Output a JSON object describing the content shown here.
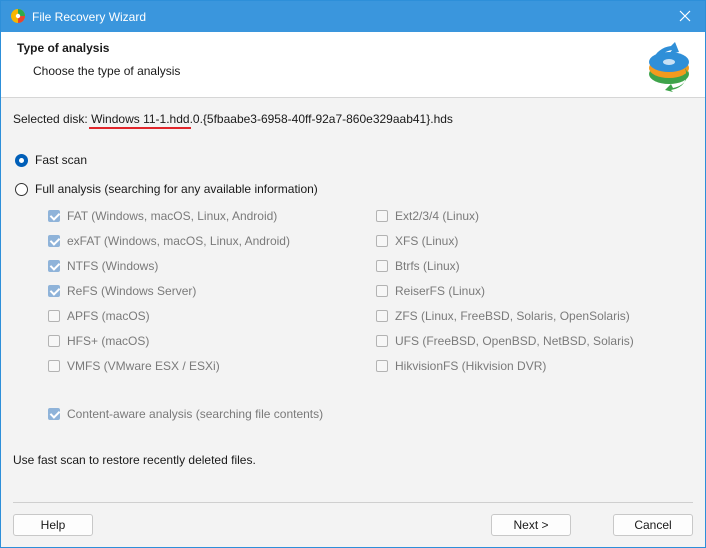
{
  "window": {
    "title": "File Recovery Wizard"
  },
  "header": {
    "title": "Type of analysis",
    "subtitle": "Choose the type of analysis"
  },
  "disk": {
    "label": "Selected disk:",
    "name": "Windows 11-1.hdd",
    "suffix": ".0.{5fbaabe3-6958-40ff-92a7-860e329aab41}.hds"
  },
  "scan_options": {
    "fast": {
      "label": "Fast scan",
      "selected": true
    },
    "full": {
      "label": "Full analysis (searching for any available information)",
      "selected": false
    }
  },
  "filesystems_left": [
    {
      "label": "FAT (Windows, macOS, Linux, Android)",
      "checked": true
    },
    {
      "label": "exFAT (Windows, macOS, Linux, Android)",
      "checked": true
    },
    {
      "label": "NTFS (Windows)",
      "checked": true
    },
    {
      "label": "ReFS (Windows Server)",
      "checked": true
    },
    {
      "label": "APFS (macOS)",
      "checked": false
    },
    {
      "label": "HFS+ (macOS)",
      "checked": false
    },
    {
      "label": "VMFS (VMware ESX / ESXi)",
      "checked": false
    }
  ],
  "filesystems_right": [
    {
      "label": "Ext2/3/4 (Linux)",
      "checked": false
    },
    {
      "label": "XFS (Linux)",
      "checked": false
    },
    {
      "label": "Btrfs (Linux)",
      "checked": false
    },
    {
      "label": "ReiserFS (Linux)",
      "checked": false
    },
    {
      "label": "ZFS (Linux, FreeBSD, Solaris, OpenSolaris)",
      "checked": false
    },
    {
      "label": "UFS (FreeBSD, OpenBSD, NetBSD, Solaris)",
      "checked": false
    },
    {
      "label": "HikvisionFS (Hikvision DVR)",
      "checked": false
    }
  ],
  "content_aware": {
    "label": "Content-aware analysis (searching file contents)",
    "checked": true
  },
  "hint": "Use fast scan to restore recently deleted files.",
  "buttons": {
    "help": "Help",
    "next": "Next >",
    "cancel": "Cancel"
  },
  "colors": {
    "titlebar": "#3a96dd",
    "accent": "#005fb8",
    "underline": "#e0262b"
  }
}
